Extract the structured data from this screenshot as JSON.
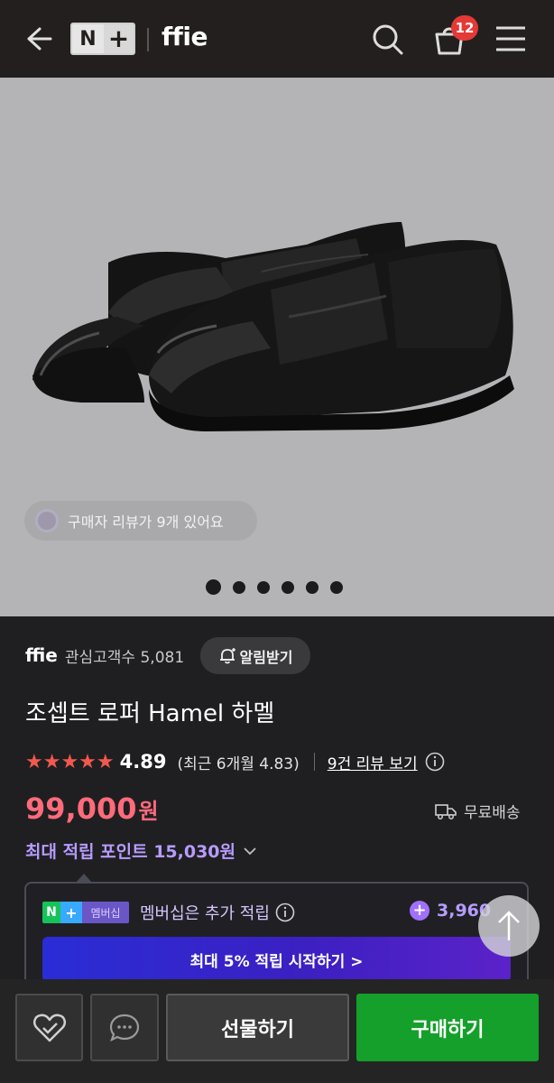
{
  "header": {
    "back_icon": "arrow-left-icon",
    "nplus_letters": {
      "n": "N",
      "plus": "+"
    },
    "brand": "ffie",
    "cart_count": "12"
  },
  "product_image": {
    "review_chip": "구매자 리뷰가 9개 있어요",
    "pager": {
      "total": 6,
      "active": 1
    }
  },
  "store": {
    "name": "ffie",
    "fans": "관심고객수 5,081",
    "alert_label": "알림받기"
  },
  "product": {
    "title": "조셉트 로퍼 Hamel 하멜",
    "stars": "★★★★★",
    "rating": "4.89",
    "recent_rating": "(최근 6개월 4.83)",
    "review_link": "9건 리뷰 보기",
    "price": "99,000",
    "price_unit": "원",
    "shipping": "무료배송",
    "max_points": "최대 적립 포인트 15,030원"
  },
  "membership": {
    "badge_n": "N",
    "badge_plus": "+",
    "badge_label": "멤버십",
    "text": "멤버십은 추가 적립",
    "points_value": "3,960",
    "plus_sign": "+",
    "start_button": "최대 5% 적립 시작하기 >"
  },
  "bottom": {
    "gift_label": "선물하기",
    "buy_label": "구매하기"
  },
  "colors": {
    "header_bg": "#231f1e",
    "price": "#ff6b7b",
    "points": "#b79cff",
    "stars": "#f2584e",
    "buy_button": "#14a02a",
    "cart_badge": "#e53935"
  }
}
